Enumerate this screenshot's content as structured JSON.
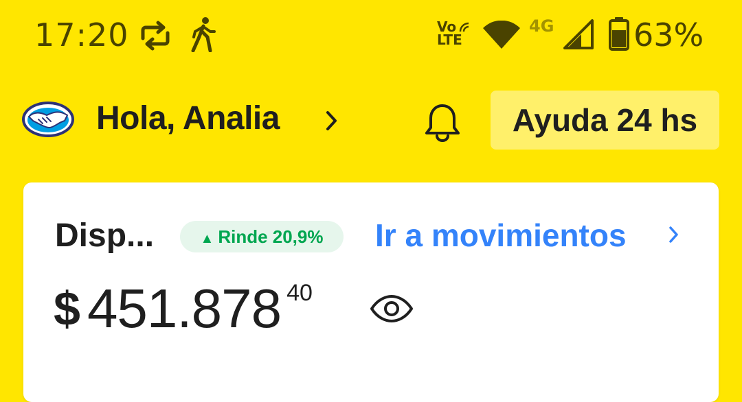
{
  "status_bar": {
    "time": "17:20",
    "icons": [
      "sync-icon",
      "walking-icon",
      "volte-icon",
      "wifi-icon",
      "signal-icon",
      "battery-icon"
    ],
    "volte_top": "Vo",
    "volte_bottom": "LTE",
    "network": "4G",
    "battery": "63%"
  },
  "header": {
    "greeting": "Hola, Analia",
    "help_label": "Ayuda 24 hs",
    "icons": [
      "handshake-logo-icon",
      "chevron-right-icon",
      "bell-icon"
    ]
  },
  "account_card": {
    "title": "Disp...",
    "yield_arrow": "▲",
    "yield_label": "Rinde 20,9%",
    "movements_link": "Ir a movimientos",
    "currency": "$",
    "amount": "451.878",
    "cents": "40",
    "icons": [
      "eye-icon",
      "chevron-right-icon"
    ]
  },
  "colors": {
    "brand_yellow": "#FFE600",
    "help_button_bg": "#FFF06A",
    "link_blue": "#3483FA",
    "yield_green": "#00A650",
    "yield_bg": "#E6F6EC"
  }
}
